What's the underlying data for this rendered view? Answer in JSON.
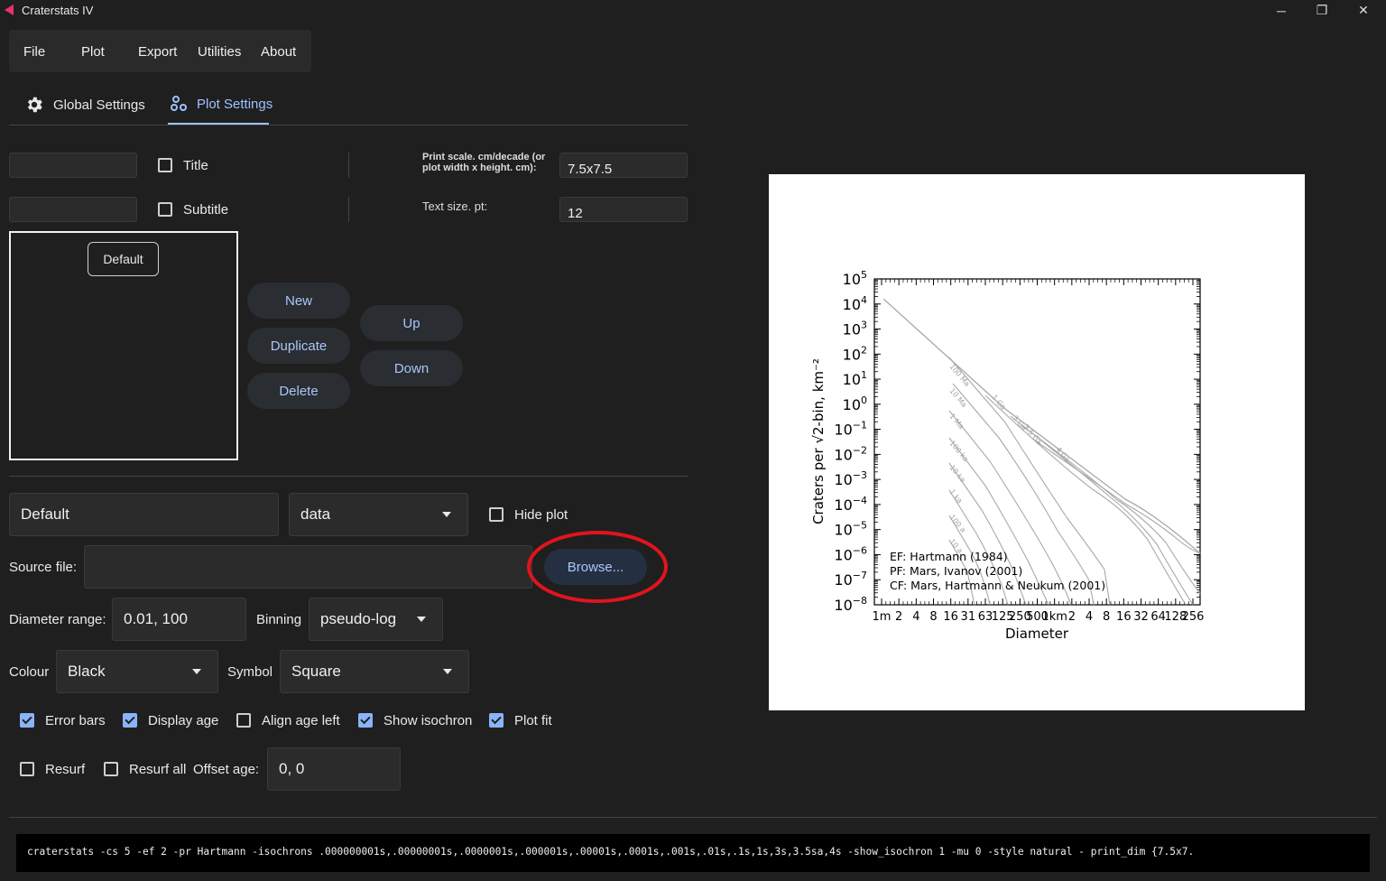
{
  "window": {
    "title": "Craterstats IV",
    "minimize": "─",
    "restore": "❐",
    "close": "✕"
  },
  "menu": [
    "File",
    "Plot",
    "Export",
    "Utilities",
    "About"
  ],
  "tabs": {
    "global": "Global Settings",
    "plot": "Plot Settings",
    "active": "Plot Settings"
  },
  "settings": {
    "title_value": "",
    "title_label": "Title",
    "subtitle_value": "",
    "subtitle_label": "Subtitle",
    "print_scale_label": "Print scale. cm/decade (or plot width x height. cm):",
    "print_scale_value": "7.5x7.5",
    "text_size_label": "Text size. pt:",
    "text_size_value": "12"
  },
  "plot_list": {
    "items": [
      "Default"
    ],
    "buttons": {
      "new": "New",
      "duplicate": "Duplicate",
      "delete": "Delete",
      "up": "Up",
      "down": "Down"
    }
  },
  "plot_item": {
    "name": "Default",
    "type": "data",
    "hide_plot_label": "Hide plot",
    "source_file_label": "Source file:",
    "source_file_value": "",
    "browse_label": "Browse...",
    "diameter_range_label": "Diameter range:",
    "diameter_range_value": "0.01, 100",
    "binning_label": "Binning",
    "binning_value": "pseudo-log",
    "colour_label": "Colour",
    "colour_value": "Black",
    "symbol_label": "Symbol",
    "symbol_value": "Square",
    "checks": {
      "error_bars": {
        "label": "Error bars",
        "checked": true
      },
      "display_age": {
        "label": "Display age",
        "checked": true
      },
      "align_age_left": {
        "label": "Align age left",
        "checked": false
      },
      "show_isochron": {
        "label": "Show isochron",
        "checked": true
      },
      "plot_fit": {
        "label": "Plot fit",
        "checked": true
      },
      "resurf": {
        "label": "Resurf",
        "checked": false
      },
      "resurf_all": {
        "label": "Resurf all",
        "checked": false
      }
    },
    "offset_age_label": "Offset age:",
    "offset_age_value": "0, 0"
  },
  "command": "craterstats -cs 5 -ef 2 -pr Hartmann -isochrons .000000001s,.00000001s,.0000001s,.000001s,.00001s,.0001s,.001s,.01s,.1s,1s,3s,3.5sa,4s -show_isochron 1 -mu 0 -style natural - print_dim {7.5x7.",
  "colors": {
    "background": "#1f1f1f",
    "accent": "#9fc1ff",
    "highlight_ring": "#e0141e"
  },
  "chart_data": {
    "type": "line",
    "ylabel": "Craters per √2-bin, km⁻²",
    "xlabel": "Diameter",
    "y_scale": "log",
    "x_scale": "log",
    "ylim": [
      1e-08,
      100000.0
    ],
    "y_ticks": [
      {
        "base": "10",
        "exp": "5"
      },
      {
        "base": "10",
        "exp": "4"
      },
      {
        "base": "10",
        "exp": "3"
      },
      {
        "base": "10",
        "exp": "2"
      },
      {
        "base": "10",
        "exp": "1"
      },
      {
        "base": "10",
        "exp": "0"
      },
      {
        "base": "10",
        "exp": "−1"
      },
      {
        "base": "10",
        "exp": "−2"
      },
      {
        "base": "10",
        "exp": "−3"
      },
      {
        "base": "10",
        "exp": "−4"
      },
      {
        "base": "10",
        "exp": "−5"
      },
      {
        "base": "10",
        "exp": "−6"
      },
      {
        "base": "10",
        "exp": "−7"
      },
      {
        "base": "10",
        "exp": "−8"
      }
    ],
    "x_ticks": [
      "1m",
      "2",
      "4",
      "8",
      "16",
      "31",
      "63",
      "125",
      "250",
      "500",
      "1km",
      "2",
      "4",
      "8",
      "16",
      "32",
      "64",
      "128",
      "256"
    ],
    "isochron_labels": [
      "100 Ma",
      "10 Ma",
      "1 Ma",
      "100 ka",
      "10 ka",
      "1 ka",
      "100 a",
      "10 a",
      "1 Ga",
      "3 Ga",
      "3.5 Ga",
      "4 Ga"
    ],
    "legend": [
      "EF: Hartmann (1984)",
      "PF: Mars, Ivanov (2001)",
      "CF: Mars, Hartmann & Neukum (2001)"
    ]
  }
}
